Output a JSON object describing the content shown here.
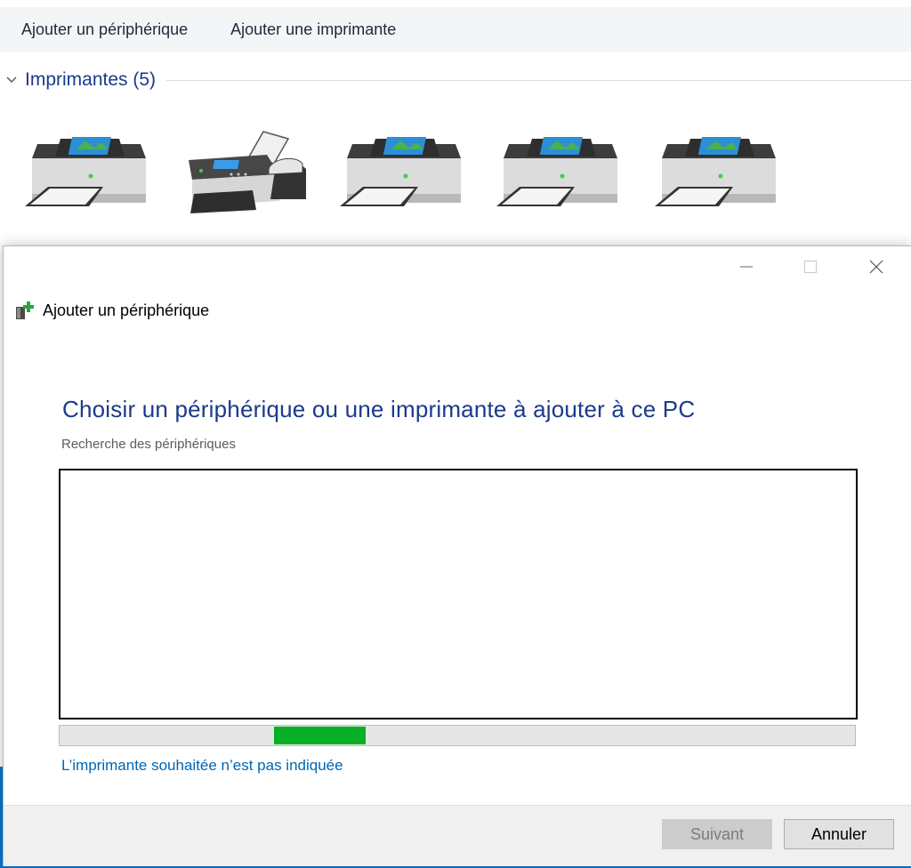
{
  "background": {
    "toolbar": {
      "add_device": "Ajouter un périphérique",
      "add_printer": "Ajouter une imprimante"
    },
    "group": {
      "title": "Imprimantes (5)",
      "devices": [
        {
          "icon": "printer-icon"
        },
        {
          "icon": "fax-icon"
        },
        {
          "icon": "printer-icon"
        },
        {
          "icon": "printer-icon"
        },
        {
          "icon": "printer-icon"
        }
      ]
    }
  },
  "dialog": {
    "title": "Ajouter un périphérique",
    "icon": "add-device-icon",
    "heading": "Choisir un périphérique ou une imprimante à ajouter à ce PC",
    "status": "Recherche des périphériques",
    "link": "L’imprimante souhaitée n’est pas indiquée",
    "progress_fraction": 0.27,
    "buttons": {
      "next": "Suivant",
      "cancel": "Annuler"
    }
  },
  "colors": {
    "heading": "#1b3a8c",
    "link": "#0066b4",
    "progress": "#06b025",
    "accent": "#0078d7"
  }
}
